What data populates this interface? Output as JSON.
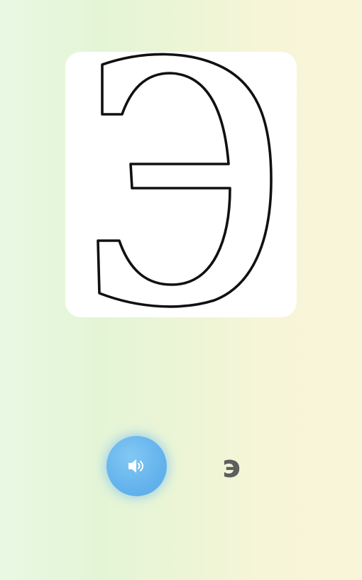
{
  "letter_card": {
    "letter": "Э",
    "icon": "cyrillic-e-outline-icon"
  },
  "sound_button": {
    "icon": "speaker-icon",
    "color": "#64b3ed"
  },
  "letter_label": "э",
  "colors": {
    "background_left": "#e9f8e4",
    "background_right": "#f8f5d9",
    "label": "#5e5e5e"
  }
}
